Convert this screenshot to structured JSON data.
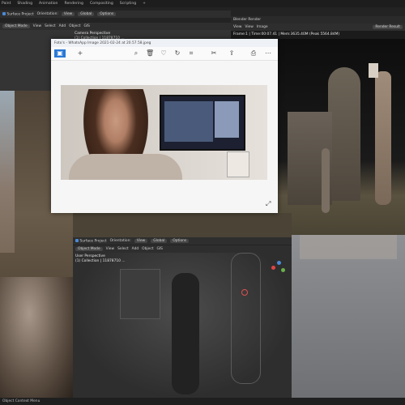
{
  "topmenu": [
    "Paint",
    "Shading",
    "Animation",
    "Rendering",
    "Compositing",
    "Scripting",
    "+"
  ],
  "top_viewport": {
    "options": "Options",
    "header": [
      "Object Mode",
      "View",
      "Select",
      "Add",
      "Object",
      "GIS"
    ],
    "orientation": "Orientation:",
    "orientation_value": "View",
    "transform": "Global",
    "snap": "Surface Project",
    "perspective": "Camera Perspective",
    "collection": "(1) Collection | 11878710 ...",
    "object_name": "380843_..."
  },
  "render_window": {
    "title": "Blender Render",
    "menu": [
      "View",
      "View",
      "Image"
    ],
    "render_layer": "Render Result",
    "stats": "Frame:1 | Time:00:07.41 | Mem:3635.40M (Peak 5564.84M)"
  },
  "photos_window": {
    "title": "Foto's - WhatsApp Image 2021-02-24 at 20.57.58.jpeg",
    "tools": [
      "image-icon",
      "plus-icon",
      "zoom-icon",
      "trash-icon",
      "heart-icon",
      "rotate-icon",
      "crop-icon",
      "edit-icon",
      "share-icon",
      "print-icon",
      "more-icon"
    ],
    "expand_icon": "expand-icon"
  },
  "bottom_viewport": {
    "header": [
      "Object Mode",
      "View",
      "Select",
      "Add",
      "Object",
      "GIS"
    ],
    "orientation": "Orientation:",
    "orientation_value": "View",
    "transform": "Global",
    "snap": "Surface Project",
    "options": "Options",
    "perspective": "User Perspective",
    "collection": "(1) Collection | 11878710 ..."
  },
  "status": "Object Context Menu",
  "colors": {
    "accent": "#4a8ad6",
    "bg_dark": "#232323",
    "header": "#2e2e2e",
    "photos_bg": "#f6f6f6"
  }
}
